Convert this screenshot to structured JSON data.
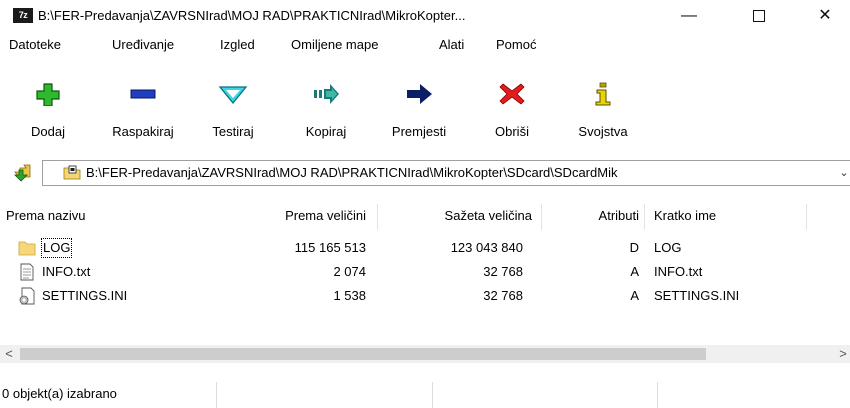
{
  "window": {
    "app_icon_text": "7z",
    "title": "B:\\FER-Predavanja\\ZAVRSNIrad\\MOJ RAD\\PRAKTICNIrad\\MikroKopter...",
    "minimize": "—",
    "close": "✕"
  },
  "menu": [
    "Datoteke",
    "Uređivanje",
    "Izgled",
    "Omiljene mape",
    "Alati",
    "Pomoć"
  ],
  "toolbar": [
    {
      "label": "Dodaj",
      "icon": "add-icon"
    },
    {
      "label": "Raspakiraj",
      "icon": "extract-icon"
    },
    {
      "label": "Testiraj",
      "icon": "test-icon"
    },
    {
      "label": "Kopiraj",
      "icon": "copy-icon"
    },
    {
      "label": "Premjesti",
      "icon": "move-icon"
    },
    {
      "label": "Obriši",
      "icon": "delete-icon"
    },
    {
      "label": "Svojstva",
      "icon": "info-icon"
    }
  ],
  "address": {
    "path": "B:\\FER-Predavanja\\ZAVRSNIrad\\MOJ RAD\\PRAKTICNIrad\\MikroKopter\\SDcard\\SDcardMik",
    "dropdown": "⌄"
  },
  "columns": [
    "Prema nazivu",
    "Prema veličini",
    "Sažeta veličina",
    "Atributi",
    "Kratko ime"
  ],
  "rows": [
    {
      "name": "LOG",
      "size": "115 165 513",
      "packed": "123 043 840",
      "attr": "D",
      "short": "LOG",
      "icon": "folder-icon"
    },
    {
      "name": "INFO.txt",
      "size": "2 074",
      "packed": "32 768",
      "attr": "A",
      "short": "INFO.txt",
      "icon": "text-file-icon"
    },
    {
      "name": "SETTINGS.INI",
      "size": "1 538",
      "packed": "32 768",
      "attr": "A",
      "short": "SETTINGS.INI",
      "icon": "settings-file-icon"
    }
  ],
  "scrollbar": {
    "left": "<",
    "right": ">"
  },
  "status": {
    "text": "0 objekt(a) izabrano"
  },
  "colors": {
    "add_green": "#2db82d",
    "extract_blue": "#1f3fbf",
    "test_cyan": "#3ad6e6",
    "copy_teal": "#1a7a7a",
    "move_navy": "#0b1f66",
    "delete_red": "#e01c1c",
    "info_olive": "#b6a300"
  }
}
